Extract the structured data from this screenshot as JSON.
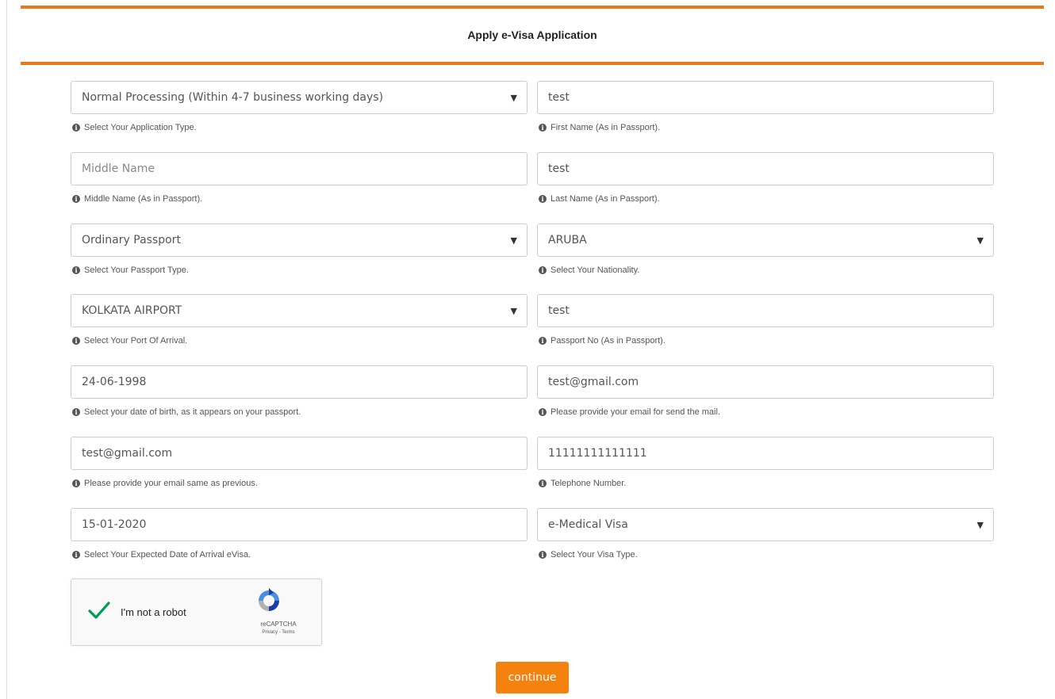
{
  "form": {
    "title": "Apply e-Visa Application",
    "fields": [
      {
        "value": "Normal Processing (Within 4-7 business working days)",
        "help": "Select Your Application Type.",
        "type": "select"
      },
      {
        "value": "test",
        "help": "First Name (As in Passport).",
        "type": "text"
      },
      {
        "placeholder": "Middle Name",
        "help": "Middle Name (As in Passport).",
        "type": "text"
      },
      {
        "value": "test",
        "help": "Last Name (As in Passport).",
        "type": "text"
      },
      {
        "value": "Ordinary Passport",
        "help": "Select Your Passport Type.",
        "type": "select"
      },
      {
        "value": "ARUBA",
        "help": "Select Your Nationality.",
        "type": "select"
      },
      {
        "value": "KOLKATA AIRPORT",
        "help": "Select Your Port Of Arrival.",
        "type": "select"
      },
      {
        "value": "test",
        "help": "Passport No (As in Passport).",
        "type": "text"
      },
      {
        "value": "24-06-1998",
        "help": "Select your date of birth, as it appears on your passport.",
        "type": "date"
      },
      {
        "value": "test@gmail.com",
        "help": "Please provide your email for send the mail.",
        "type": "email"
      },
      {
        "value": "test@gmail.com",
        "help": "Please provide your email same as previous.",
        "type": "email"
      },
      {
        "value": "11111111111111",
        "help": "Telephone Number.",
        "type": "tel"
      },
      {
        "value": "15-01-2020",
        "help": "Select Your Expected Date of Arrival eVisa.",
        "type": "date"
      },
      {
        "value": "e-Medical Visa",
        "help": "Select Your Visa Type.",
        "type": "select"
      }
    ],
    "info_icon": "info-circle-icon",
    "caret_icon": "caret-down-icon",
    "captcha": {
      "label": "I'm not a robot",
      "brand": "reCAPTCHA",
      "terms": "Privacy - Terms",
      "checked": true,
      "check_icon": "checkmark-icon",
      "logo_icon": "recaptcha-logo-icon"
    },
    "continue_label": "continue"
  },
  "colors": {
    "accent": "#e8791b",
    "button": "#f5820e",
    "check": "#009e55"
  }
}
